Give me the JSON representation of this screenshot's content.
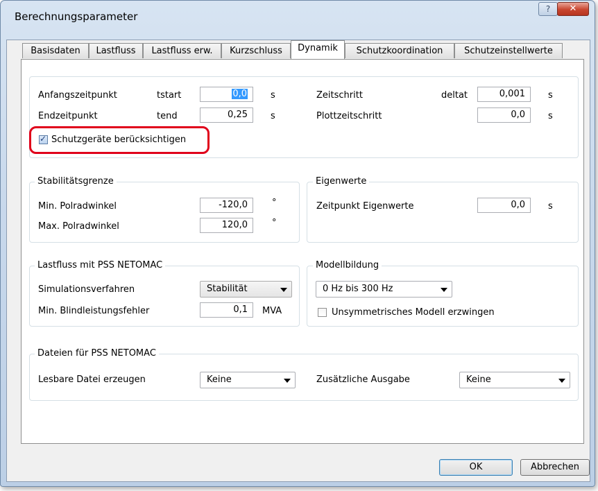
{
  "window": {
    "title": "Berechnungsparameter",
    "help_label": "?",
    "close_label": "✕"
  },
  "tabs": [
    {
      "label": "Basisdaten"
    },
    {
      "label": "Lastfluss"
    },
    {
      "label": "Lastfluss erw."
    },
    {
      "label": "Kurzschluss"
    },
    {
      "label": "Dynamik"
    },
    {
      "label": "Schutzkoordination"
    },
    {
      "label": "Schutzeinstellwerte"
    }
  ],
  "active_tab": "Dynamik",
  "time": {
    "start": {
      "label": "Anfangszeitpunkt",
      "symbol": "tstart",
      "value": "0,0",
      "unit": "s"
    },
    "end": {
      "label": "Endzeitpunkt",
      "symbol": "tend",
      "value": "0,25",
      "unit": "s"
    },
    "step": {
      "label": "Zeitschritt",
      "symbol": "deltat",
      "value": "0,001",
      "unit": "s"
    },
    "plot_step": {
      "label": "Plottzeitschritt",
      "value": "0,0",
      "unit": "s"
    },
    "protection_checkbox": {
      "label": "Schutzgeräte berücksichtigen",
      "checked": true
    }
  },
  "stability": {
    "title": "Stabilitätsgrenze",
    "min": {
      "label": "Min. Polradwinkel",
      "value": "-120,0",
      "unit": "°"
    },
    "max": {
      "label": "Max. Polradwinkel",
      "value": "120,0",
      "unit": "°"
    }
  },
  "eigen": {
    "title": "Eigenwerte",
    "time": {
      "label": "Zeitpunkt Eigenwerte",
      "value": "0,0",
      "unit": "s"
    }
  },
  "loadflow": {
    "title": "Lastfluss mit PSS NETOMAC",
    "sim": {
      "label": "Simulationsverfahren",
      "value": "Stabilität"
    },
    "reactive": {
      "label": "Min. Blindleistungsfehler",
      "value": "0,1",
      "unit": "MVA"
    }
  },
  "model": {
    "title": "Modellbildung",
    "range": {
      "value": "0 Hz bis 300 Hz"
    },
    "asym_checkbox": {
      "label": "Unsymmetrisches Modell erzwingen",
      "checked": false
    }
  },
  "files": {
    "title": "Dateien für PSS NETOMAC",
    "readable": {
      "label": "Lesbare Datei erzeugen",
      "value": "Keine"
    },
    "extra": {
      "label": "Zusätzliche Ausgabe",
      "value": "Keine"
    }
  },
  "buttons": {
    "ok": "OK",
    "cancel": "Abbrechen"
  },
  "colors": {
    "highlight": "#e0001b",
    "selection": "#3399ff",
    "titlebar": "#c9d9ec"
  }
}
